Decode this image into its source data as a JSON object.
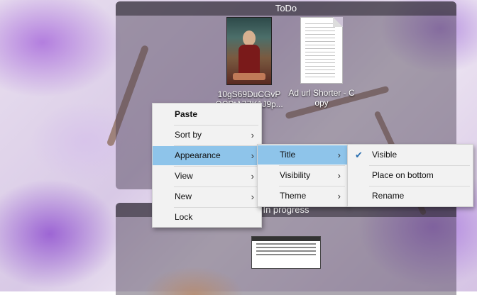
{
  "fences": {
    "todo": {
      "title": "ToDo",
      "items": [
        {
          "label": "10gS69DuCGvP OCPtA7ZK1J9p..."
        },
        {
          "label": "Ad url Shorter - Copy"
        }
      ]
    },
    "inprogress": {
      "title": "In progress"
    }
  },
  "context_menu": {
    "paste": "Paste",
    "sort_by": "Sort by",
    "appearance": "Appearance",
    "view": "View",
    "new": "New",
    "lock": "Lock"
  },
  "appearance_submenu": {
    "title": "Title",
    "visibility": "Visibility",
    "theme": "Theme"
  },
  "title_submenu": {
    "visible": "Visible",
    "place_on_bottom": "Place on bottom",
    "rename": "Rename"
  },
  "colors": {
    "highlight": "#8ec4ea",
    "check": "#2a6fb0"
  }
}
